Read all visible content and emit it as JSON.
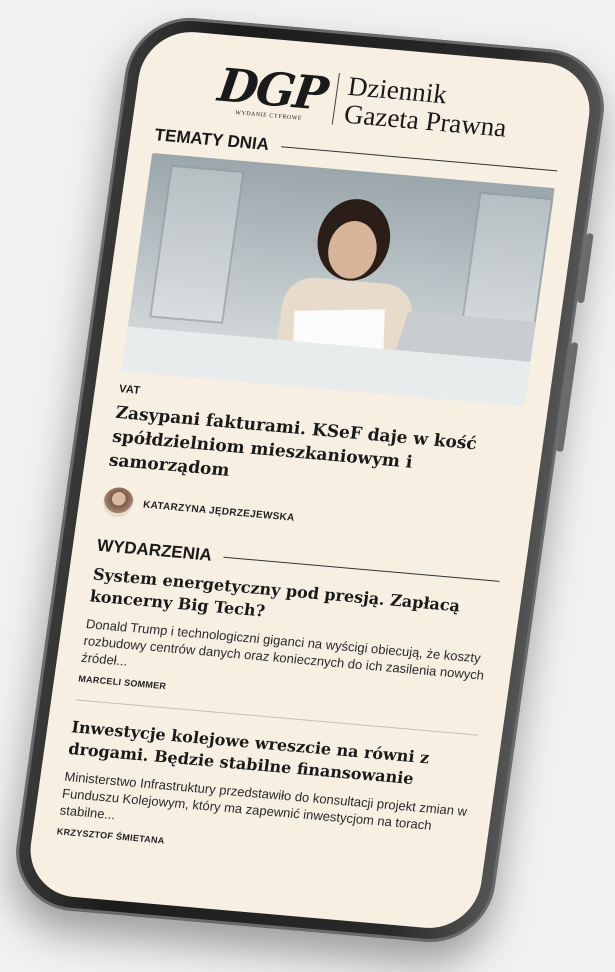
{
  "masthead": {
    "logo_text": "DGP",
    "logo_sub": "WYDANIE CYFROWE",
    "title_line1": "Dziennik",
    "title_line2": "Gazeta Prawna"
  },
  "topics": {
    "section_title": "TEMATY DNIA",
    "hero_article": {
      "category": "VAT",
      "headline": "Zasypani fakturami. KSeF daje w kość spółdzielniom mieszkaniowym i samorządom",
      "author": "KATARZYNA JĘDRZEJEWSKA"
    }
  },
  "events": {
    "section_title": "WYDARZENIA",
    "articles": [
      {
        "title": "System energetyczny pod presją. Zapłacą koncerny Big Tech?",
        "lead": "Donald Trump i technologiczni giganci na wyścigi obiecują, że koszty rozbudowy centrów danych oraz koniecznych do ich zasilenia nowych źródeł...",
        "author": "MARCELI SOMMER"
      },
      {
        "title": "Inwestycje kolejowe wreszcie na równi z drogami. Będzie stabilne finansowanie",
        "lead": "Ministerstwo Infrastruktury przedstawiło do konsultacji projekt zmian w Funduszu Kolejowym, który ma zapewnić inwestycjom na torach stabilne...",
        "author": "KRZYSZTOF ŚMIETANA"
      }
    ]
  }
}
